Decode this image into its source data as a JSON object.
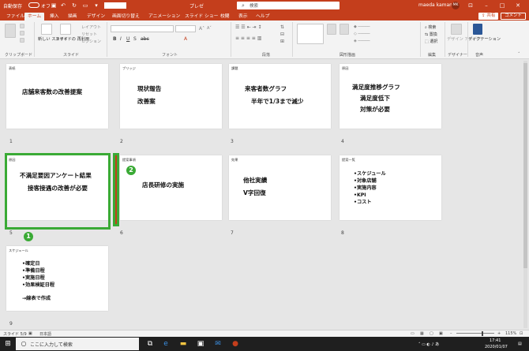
{
  "title_bar": {
    "autosave_label": "自動保存",
    "autosave_state": "オフ",
    "doc_title": "プレゼ",
    "search_placeholder": "検索",
    "user_name": "maeda kaman",
    "user_initials": "MK"
  },
  "tabs": [
    "ファイル",
    "ホーム",
    "挿入",
    "描画",
    "デザイン",
    "画面切り替え",
    "アニメーション",
    "スライド ショー",
    "校閲",
    "表示",
    "ヘルプ"
  ],
  "active_tab": "ホーム",
  "share_label": "共有",
  "comment_label": "コメント",
  "ribbon": {
    "groups": [
      "クリップボード",
      "スライド",
      "フォント",
      "段落",
      "図形描画",
      "編集",
      "デザイナー",
      "音声"
    ],
    "new_slide_label": "新しい スライド",
    "reuse_label": "スライドの 再利用",
    "layout_label": "レイアウト",
    "reset_label": "リセット",
    "section_label": "セクション",
    "find_label": "検索",
    "replace_label": "置換",
    "select_label": "選択",
    "design_ideas_label": "デザイン アイデア",
    "dictate_label": "ディクテーション"
  },
  "slides": [
    {
      "num": "1",
      "tag": "表紙",
      "lines": [
        "店舗来客数の改善提案"
      ]
    },
    {
      "num": "2",
      "tag": "ブリッジ",
      "lines": [
        "現状報告",
        "改善案"
      ]
    },
    {
      "num": "3",
      "tag": "課題",
      "lines": [
        "来客者数グラフ",
        "半年で1/3まで減少"
      ]
    },
    {
      "num": "4",
      "tag": "原因",
      "lines": [
        "満足度推移グラフ",
        "満足度低下",
        "対策が必要"
      ]
    },
    {
      "num": "5",
      "tag": "原因",
      "lines": [
        "不満足要因アンケート結果",
        "接客接遇の改善が必要"
      ]
    },
    {
      "num": "6",
      "tag": "提案事項",
      "lines": [
        "店長研修の実施"
      ]
    },
    {
      "num": "7",
      "tag": "効果",
      "lines": [
        "他社実績",
        "V字回復"
      ]
    },
    {
      "num": "8",
      "tag": "提案一覧",
      "lines": [
        "•スケジュール",
        "•対象店舗",
        "•実施内容",
        "•KPI",
        "•コスト"
      ]
    },
    {
      "num": "9",
      "tag": "スケジュール",
      "lines": [
        "•確定日",
        "•準備日程",
        "•実施日程",
        "•効果検証日程",
        "→線表で作成"
      ]
    }
  ],
  "badges": [
    "1",
    "2"
  ],
  "status": {
    "slide_count": "スライド 5/9",
    "language": "日本語",
    "zoom": "115%"
  },
  "taskbar": {
    "search_text": "ここに入力して検索",
    "time": "17:41",
    "date": "2020/01/07"
  },
  "colors": {
    "accent": "#c43e1c",
    "highlight": "#3aaa35"
  }
}
